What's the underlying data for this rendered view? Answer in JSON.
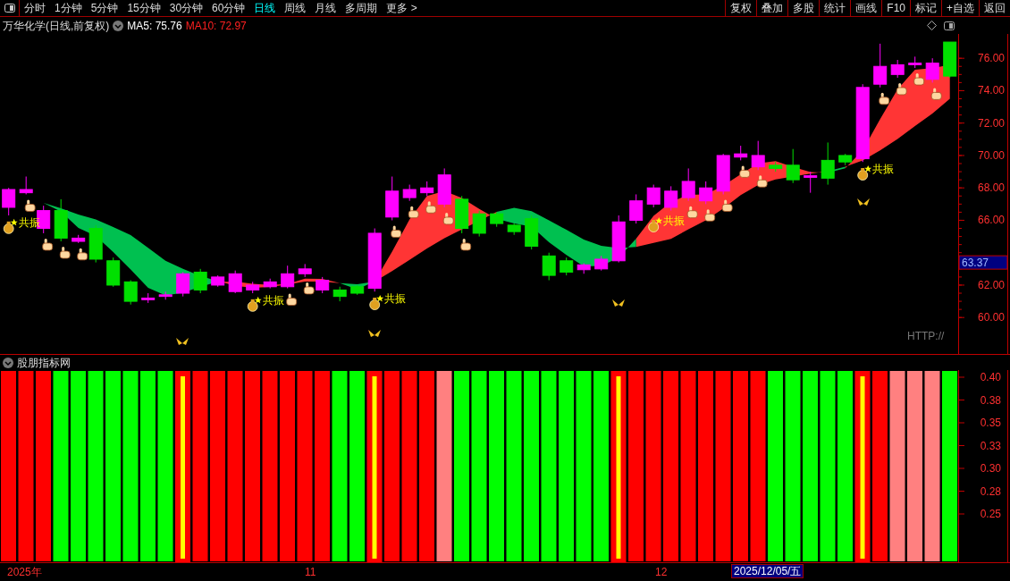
{
  "toolbar": {
    "periods": [
      {
        "label": "分时",
        "selected": false
      },
      {
        "label": "1分钟",
        "selected": false
      },
      {
        "label": "5分钟",
        "selected": false
      },
      {
        "label": "15分钟",
        "selected": false
      },
      {
        "label": "30分钟",
        "selected": false
      },
      {
        "label": "60分钟",
        "selected": false
      },
      {
        "label": "日线",
        "selected": true
      },
      {
        "label": "周线",
        "selected": false
      },
      {
        "label": "月线",
        "selected": false
      },
      {
        "label": "多周期",
        "selected": false
      },
      {
        "label": "更多 >",
        "selected": false
      }
    ],
    "actions": [
      "复权",
      "叠加",
      "多股",
      "统计",
      "画线",
      "F10",
      "标记",
      "+自选",
      "返回"
    ]
  },
  "legend": {
    "stock": "万华化学(日线,前复权)",
    "ma": [
      {
        "label": "MA5: 75.76",
        "color": "#ffffff"
      },
      {
        "label": "MA10: 72.97",
        "color": "#ff2020"
      }
    ]
  },
  "price_chart": {
    "chart_data": {
      "type": "candlestick",
      "ylim": [
        57.75,
        77.5
      ],
      "yticks": [
        {
          "value": 76,
          "label": "76.00"
        },
        {
          "value": 74,
          "label": "74.00"
        },
        {
          "value": 72,
          "label": "72.00"
        },
        {
          "value": 70,
          "label": "70.00"
        },
        {
          "value": 68,
          "label": "68.00"
        },
        {
          "value": 66,
          "label": "66.00"
        },
        {
          "value": 62,
          "label": "62.00"
        },
        {
          "value": 60,
          "label": "60.00"
        }
      ],
      "ohlc": [
        [
          66.8,
          68,
          66.3,
          67.9
        ],
        [
          67.7,
          68.7,
          67.6,
          67.9
        ],
        [
          65.5,
          66.9,
          65.2,
          66.6
        ],
        [
          66.6,
          67.3,
          64.7,
          64.9
        ],
        [
          64.7,
          65.1,
          64.6,
          64.9
        ],
        [
          65.5,
          65.7,
          63.4,
          63.6
        ],
        [
          63.5,
          63.7,
          61.9,
          62
        ],
        [
          62.2,
          62.3,
          60.8,
          61
        ],
        [
          61.1,
          61.5,
          60.9,
          61.2
        ],
        [
          61.3,
          61.6,
          61.1,
          61.4
        ],
        [
          61.5,
          62.8,
          61.3,
          62.7
        ],
        [
          62.8,
          63,
          61.5,
          61.7
        ],
        [
          62,
          62.6,
          61.9,
          62.5
        ],
        [
          61.6,
          62.9,
          61.5,
          62.7
        ],
        [
          61.7,
          62.2,
          61.5,
          62
        ],
        [
          61.9,
          62.4,
          61.8,
          62.2
        ],
        [
          61.9,
          63.2,
          61.8,
          62.7
        ],
        [
          62.7,
          63.3,
          62.5,
          63
        ],
        [
          61.7,
          62.5,
          61.5,
          62.3
        ],
        [
          61.7,
          61.9,
          61,
          61.3
        ],
        [
          61.9,
          62,
          61.4,
          61.5
        ],
        [
          61.8,
          65.5,
          61.6,
          65.2
        ],
        [
          66.2,
          68.7,
          66,
          67.8
        ],
        [
          67.4,
          68.2,
          67.2,
          67.9
        ],
        [
          67.7,
          68.4,
          67.5,
          68
        ],
        [
          67,
          69.2,
          66.8,
          68.8
        ],
        [
          67.3,
          67.5,
          65.2,
          65.5
        ],
        [
          66.4,
          66.6,
          65,
          65.2
        ],
        [
          66.4,
          66.5,
          65.6,
          65.8
        ],
        [
          65.7,
          65.8,
          65.1,
          65.3
        ],
        [
          66.1,
          66.3,
          64.2,
          64.4
        ],
        [
          63.8,
          64,
          62.3,
          62.6
        ],
        [
          63.5,
          63.7,
          62.6,
          62.8
        ],
        [
          62.95,
          63.35,
          62.7,
          63.25
        ],
        [
          63,
          63.8,
          62.9,
          63.6
        ],
        [
          63.5,
          66.3,
          63.4,
          65.9
        ],
        [
          66,
          67.6,
          65.8,
          67.2
        ],
        [
          67,
          68.2,
          66.8,
          68
        ],
        [
          66.8,
          68.1,
          66.6,
          67.8
        ],
        [
          67.4,
          69.2,
          67.2,
          68.4
        ],
        [
          67.2,
          68.4,
          67,
          68
        ],
        [
          67.8,
          70.1,
          67.6,
          70
        ],
        [
          69.9,
          70.6,
          69.7,
          70.1
        ],
        [
          69.3,
          70.9,
          69.1,
          70
        ],
        [
          69.4,
          69.6,
          69,
          69.2
        ],
        [
          69.4,
          70.4,
          68.3,
          68.5
        ],
        [
          68.65,
          69,
          67.7,
          68.75
        ],
        [
          69.7,
          70.8,
          68.2,
          68.6
        ],
        [
          70,
          70.1,
          69.4,
          69.6
        ],
        [
          69.8,
          74.4,
          69.6,
          74.2
        ],
        [
          74.4,
          76.9,
          74.2,
          75.5
        ],
        [
          75,
          75.9,
          74.8,
          75.6
        ],
        [
          75.6,
          76.1,
          75.4,
          75.7
        ],
        [
          74.7,
          76,
          74.5,
          75.7
        ],
        [
          77,
          77,
          74.8,
          74.9
        ]
      ]
    },
    "current": "63.37",
    "note": "HTTP://",
    "signals": [
      "共振",
      "共振",
      "共振",
      "共振",
      "共振"
    ]
  },
  "indicator": {
    "title": "股朋指标网",
    "axis": [
      "0.40",
      "0.38",
      "0.35",
      "0.33",
      "0.30",
      "0.28",
      "0.25"
    ],
    "bars": [
      {
        "color": "#ff0000"
      },
      {
        "color": "#ff0000"
      },
      {
        "color": "#ff0000"
      },
      {
        "color": "#00ff00"
      },
      {
        "color": "#00ff00"
      },
      {
        "color": "#00ff00"
      },
      {
        "color": "#00ff00"
      },
      {
        "color": "#00ff00"
      },
      {
        "color": "#00ff00"
      },
      {
        "color": "#00ff00"
      },
      {
        "color": "#ffff00"
      },
      {
        "color": "#ff0000"
      },
      {
        "color": "#ff0000"
      },
      {
        "color": "#ff0000"
      },
      {
        "color": "#ff0000"
      },
      {
        "color": "#ff0000"
      },
      {
        "color": "#ff0000"
      },
      {
        "color": "#ff0000"
      },
      {
        "color": "#ff0000"
      },
      {
        "color": "#00ff00"
      },
      {
        "color": "#00ff00"
      },
      {
        "color": "#ffff00"
      },
      {
        "color": "#ff0000"
      },
      {
        "color": "#ff0000"
      },
      {
        "color": "#ff0000"
      },
      {
        "color": "#ff8080"
      },
      {
        "color": "#00ff00"
      },
      {
        "color": "#00ff00"
      },
      {
        "color": "#00ff00"
      },
      {
        "color": "#00ff00"
      },
      {
        "color": "#00ff00"
      },
      {
        "color": "#00ff00"
      },
      {
        "color": "#00ff00"
      },
      {
        "color": "#00ff00"
      },
      {
        "color": "#00ff00"
      },
      {
        "color": "#ffff00"
      },
      {
        "color": "#ff0000"
      },
      {
        "color": "#ff0000"
      },
      {
        "color": "#ff0000"
      },
      {
        "color": "#ff0000"
      },
      {
        "color": "#ff0000"
      },
      {
        "color": "#ff0000"
      },
      {
        "color": "#ff0000"
      },
      {
        "color": "#ff0000"
      },
      {
        "color": "#00ff00"
      },
      {
        "color": "#00ff00"
      },
      {
        "color": "#00ff00"
      },
      {
        "color": "#00ff00"
      },
      {
        "color": "#00ff00"
      },
      {
        "color": "#ffff00"
      },
      {
        "color": "#ff0000"
      },
      {
        "color": "#ff8080"
      },
      {
        "color": "#ff8080"
      },
      {
        "color": "#ff8080"
      },
      {
        "color": "#00ff00"
      }
    ]
  },
  "date_axis": {
    "labels": [
      "2025年",
      "11",
      "12"
    ],
    "cursor": "2025/12/05/五"
  }
}
